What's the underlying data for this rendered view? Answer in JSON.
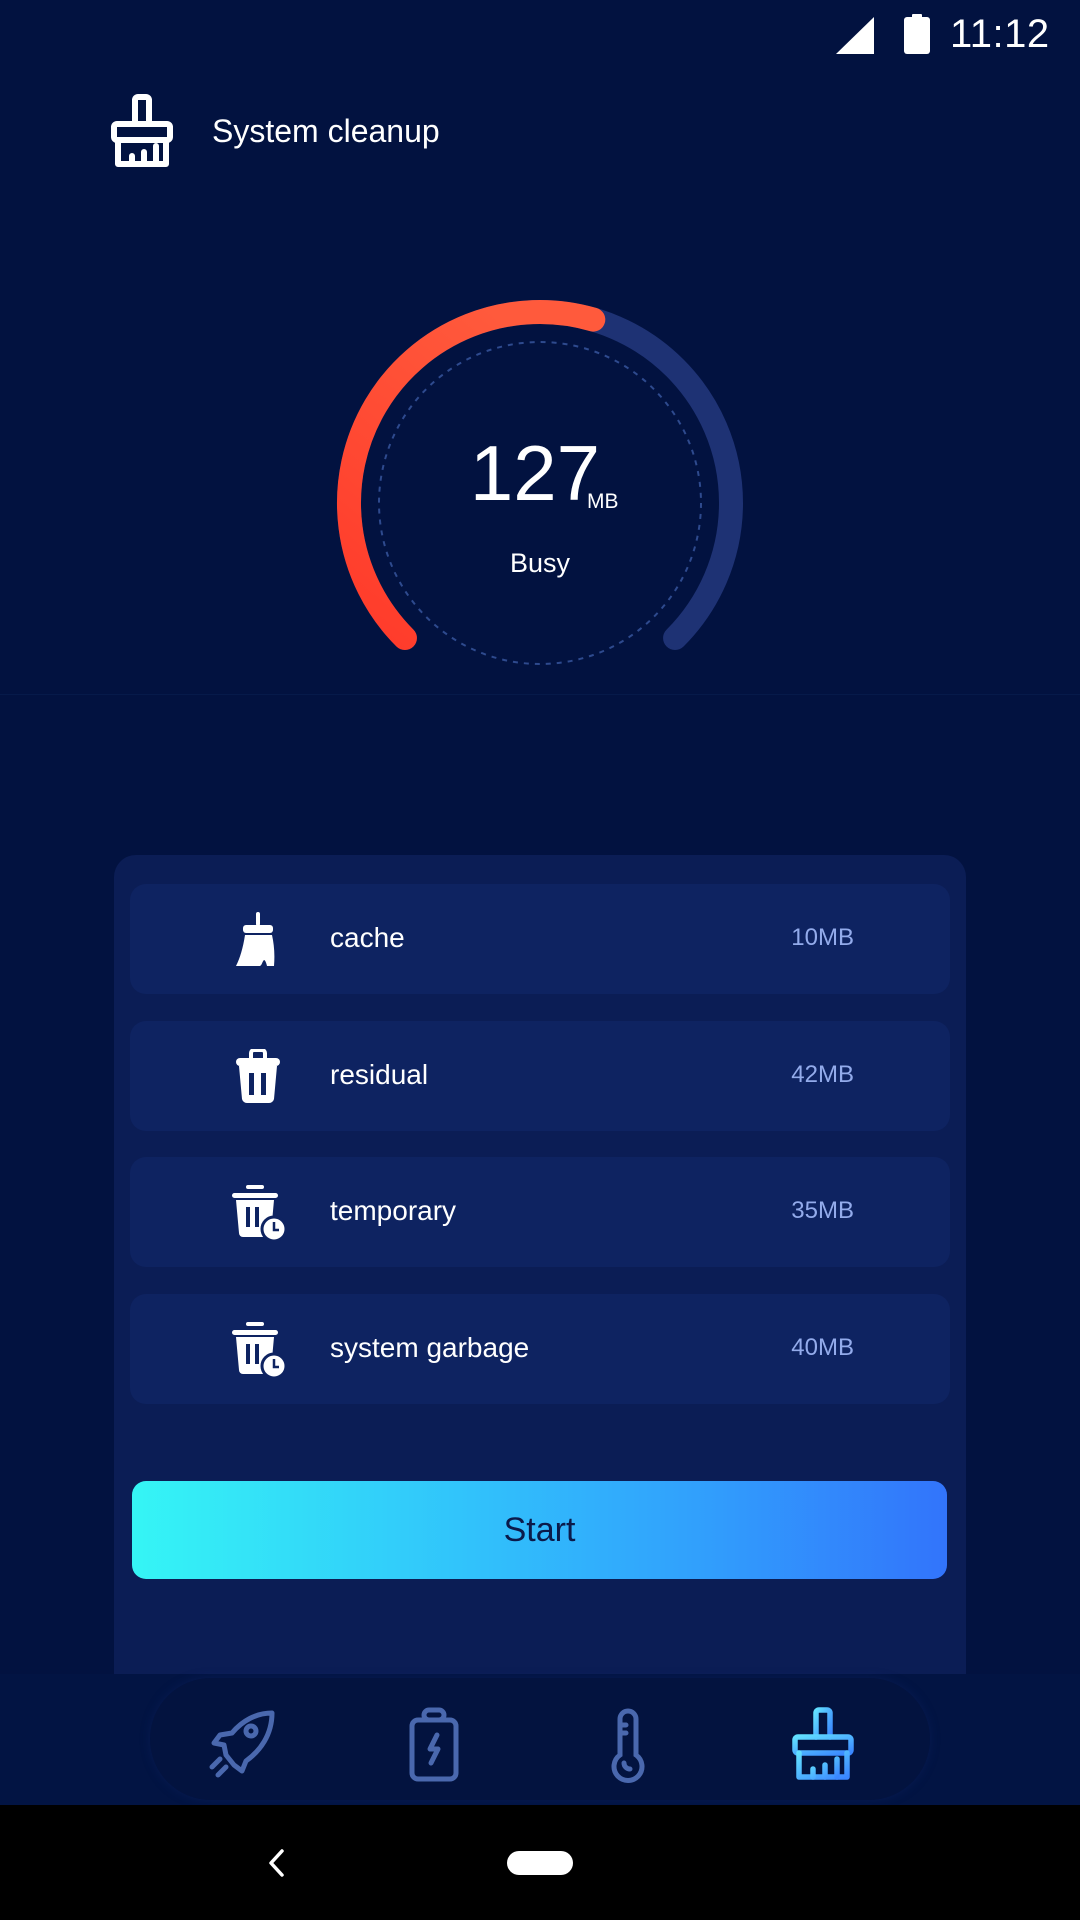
{
  "status_bar": {
    "time": "11:12",
    "icons": [
      "signal-icon",
      "battery-icon"
    ]
  },
  "header": {
    "icon": "brush-icon",
    "title": "System cleanup"
  },
  "gauge": {
    "value": "127",
    "unit": "MB",
    "status": "Busy",
    "fill_fraction": 0.56,
    "colors": {
      "fill_start": "#ff3a2a",
      "fill_end": "#ff5a3c",
      "track": "#1e3274",
      "dashed_ring": "#2e4a8e"
    }
  },
  "items": [
    {
      "icon": "broom-icon",
      "label": "cache",
      "value": "10MB"
    },
    {
      "icon": "trash-icon",
      "label": "residual",
      "value": "42MB"
    },
    {
      "icon": "trash-clock-icon",
      "label": "temporary",
      "value": "35MB"
    },
    {
      "icon": "trash-clock-icon",
      "label": "system garbage",
      "value": "40MB"
    }
  ],
  "start_button": {
    "label": "Start",
    "gradient": [
      "#35f5f5",
      "#3274fb"
    ]
  },
  "bottom_nav": {
    "items": [
      {
        "name": "boost",
        "icon": "rocket-icon",
        "active": false
      },
      {
        "name": "battery",
        "icon": "battery-charge-icon",
        "active": false
      },
      {
        "name": "cooler",
        "icon": "thermometer-icon",
        "active": false
      },
      {
        "name": "cleanup",
        "icon": "brush-icon",
        "active": true
      }
    ],
    "colors": {
      "inactive": "#4a68ae",
      "active_start": "#62e0ff",
      "active_end": "#3a86ff"
    }
  },
  "system_nav": {
    "back": "back-chevron-icon",
    "home": "home-pill"
  }
}
